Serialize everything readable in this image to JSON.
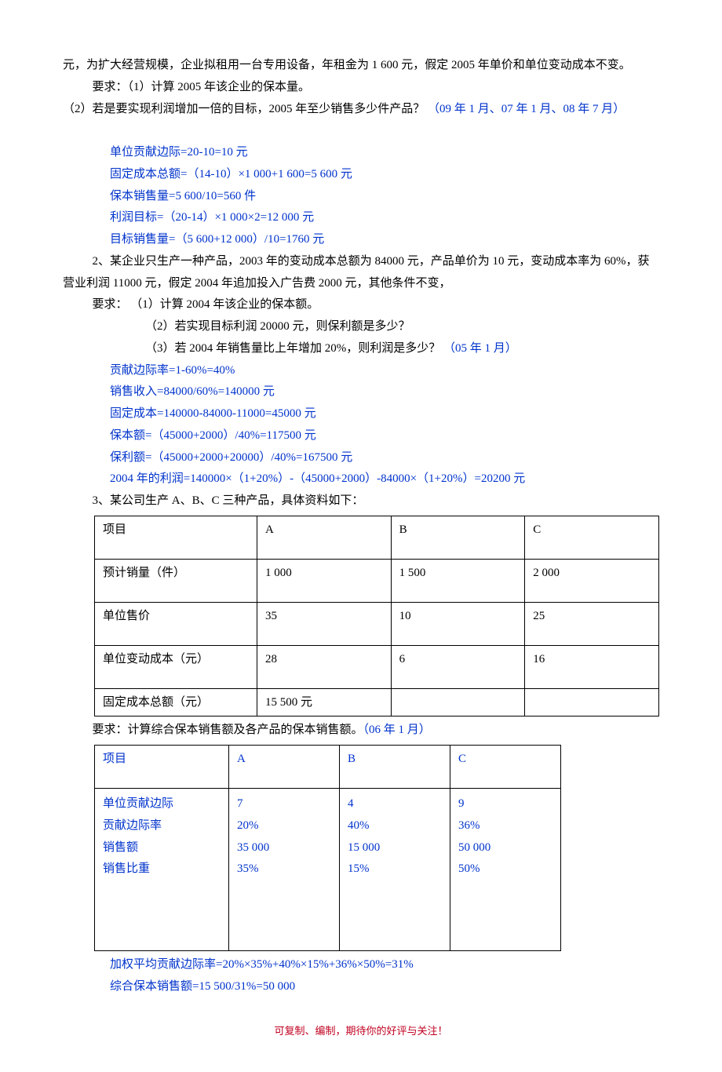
{
  "p1": "元，为扩大经营规模，企业拟租用一台专用设备，年租金为 1 600 元，假定 2005 年单价和单位变动成本不变。",
  "p2": "要求：（1）计算 2005 年该企业的保本量。",
  "p3a": "（2）若是要实现利润增加一倍的目标，2005 年至少销售多少件产品？ ",
  "p3b": "（09 年 1 月、07 年 1 月、08 年 7 月）",
  "a1": "单位贡献边际=20-10=10 元",
  "a2": "固定成本总额=（14-10）×1 000+1 600=5 600 元",
  "a3": "保本销售量=5 600/10=560 件",
  "a4": "利润目标=（20-14）×1 000×2=12 000 元",
  "a5": "目标销售量=（5 600+12 000）/10=1760 元",
  "q2a": "2、某企业只生产一种产品，2003 年的变动成本总额为 84000 元，产品单价为 10 元，变动成本率为 60%，获营业利润 11000 元，假定 2004 年追加投入广告费 2000 元，其他条件不变，",
  "q2b": "要求：  （1）计算 2004 年该企业的保本额。",
  "q2c": "（2）若实现目标利润 20000 元，则保利额是多少？",
  "q2d1": "（3）若 2004 年销售量比上年增加 20%，则利润是多少？ ",
  "q2d2": "（05 年 1 月）",
  "b1": "贡献边际率=1-60%=40%",
  "b2": "销售收入=84000/60%=140000 元",
  "b3": "固定成本=140000-84000-11000=45000 元",
  "b4": "保本额=（45000+2000）/40%=117500 元",
  "b5": "保利额=（45000+2000+20000）/40%=167500 元",
  "b6": "2004 年的利润=140000×（1+20%）-（45000+2000）-84000×（1+20%）=20200 元",
  "q3": "3、某公司生产 A、B、C 三种产品，具体资料如下：",
  "table1": {
    "r1": {
      "c1": "项目",
      "c2": "A",
      "c3": "B",
      "c4": "C"
    },
    "r2": {
      "c1": "预计销量（件）",
      "c2": "1 000",
      "c3": "1 500",
      "c4": "2 000"
    },
    "r3": {
      "c1": "单位售价",
      "c2": "35",
      "c3": "10",
      "c4": "25"
    },
    "r4": {
      "c1": "单位变动成本（元）",
      "c2": "28",
      "c3": "6",
      "c4": "16"
    },
    "r5": {
      "c1": "固定成本总额（元）",
      "c2": "15 500 元",
      "c3": "",
      "c4": ""
    }
  },
  "q3req1": "要求：计算综合保本销售额及各产品的保本销售额。",
  "q3req2": "（06 年 1 月）",
  "table2": {
    "r1": {
      "c1": "项目",
      "c2": "A",
      "c3": "B",
      "c4": "C"
    },
    "r2c1a": "单位贡献边际",
    "r2c1b": "贡献边际率",
    "r2c1c": "销售额",
    "r2c1d": "销售比重",
    "r2c2a": "7",
    "r2c2b": "20%",
    "r2c2c": "35 000",
    "r2c2d": "35%",
    "r2c3a": "4",
    "r2c3b": "40%",
    "r2c3c": "15 000",
    "r2c3d": "15%",
    "r2c4a": "9",
    "r2c4b": "36%",
    "r2c4c": "50 000",
    "r2c4d": "50%"
  },
  "c1": "加权平均贡献边际率=20%×35%+40%×15%+36%×50%=31%",
  "c2": "综合保本销售额=15 500/31%=50 000",
  "footer": "可复制、编制，期待你的好评与关注！"
}
